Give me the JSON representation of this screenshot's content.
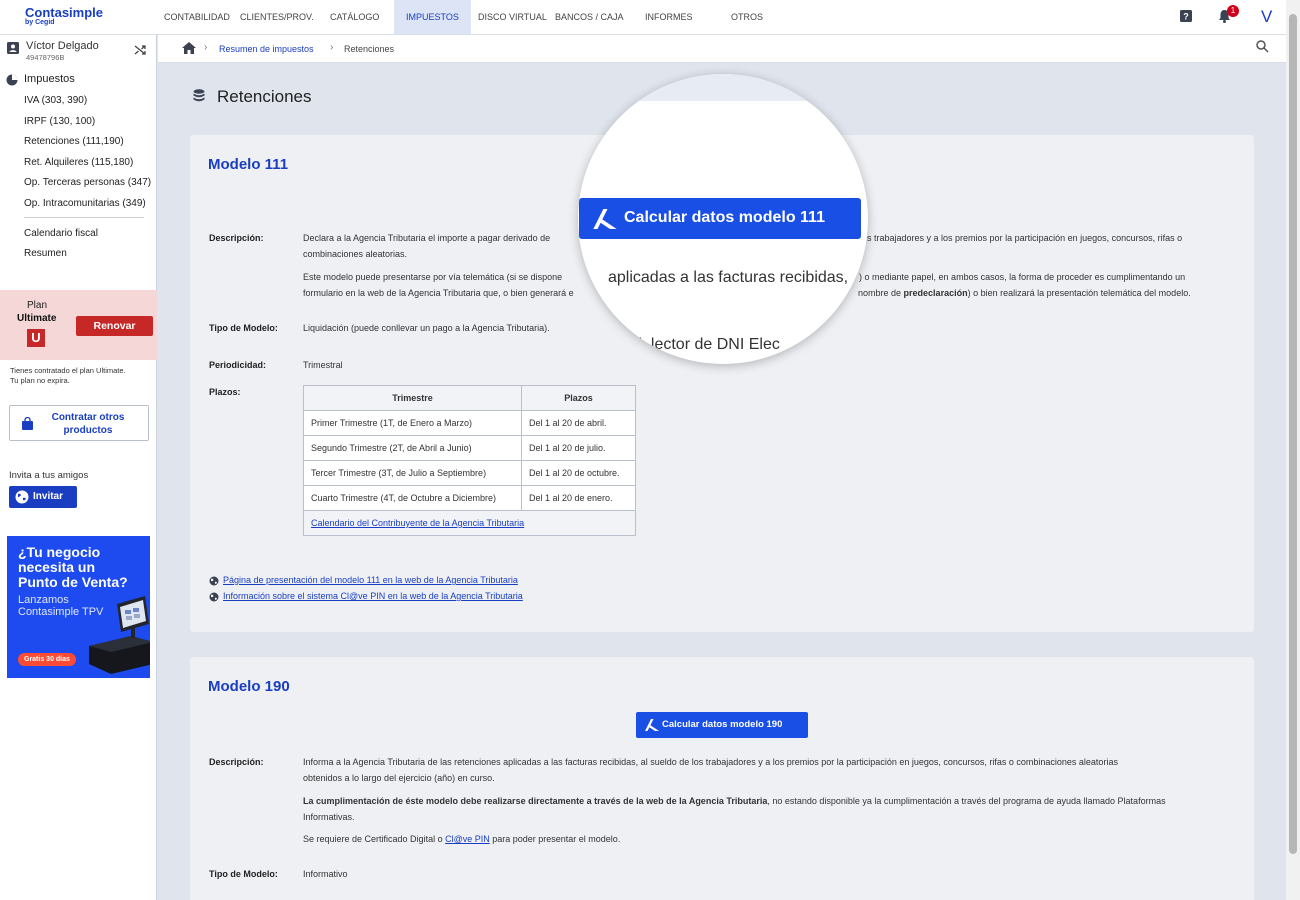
{
  "app": {
    "logo_main": "Contasimple",
    "logo_sub": "by Cegid"
  },
  "nav": {
    "items": [
      "CONTABILIDAD",
      "CLIENTES/PROV.",
      "CATÁLOGO",
      "IMPUESTOS",
      "DISCO VIRTUAL",
      "BANCOS / CAJA",
      "INFORMES",
      "OTROS"
    ],
    "active": "IMPUESTOS",
    "bell_count": "1",
    "user_initial": "V"
  },
  "user": {
    "name": "Víctor Delgado",
    "id": "49478796B"
  },
  "sidebar": {
    "section": "Impuestos",
    "items": [
      "IVA (303, 390)",
      "IRPF (130, 100)",
      "Retenciones (111,190)",
      "Ret. Alquileres (115,180)",
      "Op. Terceras personas (347)",
      "Op. Intracomunitarias (349)",
      "Calendario fiscal",
      "Resumen"
    ],
    "plan_label": "Plan",
    "plan_name": "Ultimate",
    "plan_badge": "U",
    "renew": "Renovar",
    "plan_note_1": "Tienes contratado el plan Ultimate.",
    "plan_note_2": "Tu plan no expira.",
    "contract_btn": "Contratar otros productos",
    "invite_label": "Invita a tus amigos",
    "invite_btn": "Invitar",
    "promo_title": "¿Tu negocio necesita un Punto de Venta?",
    "promo_sub": "Lanzamos Contasimple TPV",
    "promo_badge": "Gratis 30 días"
  },
  "breadcrumb": {
    "link": "Resumen de impuestos",
    "current": "Retenciones"
  },
  "page": {
    "title": "Retenciones"
  },
  "labels": {
    "desc": "Descripción:",
    "tipo": "Tipo de Modelo:",
    "periodicidad": "Periodicidad:",
    "plazos": "Plazos:"
  },
  "m111": {
    "title": "Modelo 111",
    "desc_1": "Declara a la Agencia Tributaria el importe a pagar derivado de",
    "desc_1b": "s trabajadores y a los premios por la participación en juegos, concursos, rifas o",
    "desc_2": "combinaciones aleatorias.",
    "desc_3a": "Este modelo puede presentarse por vía telemática (si se dispone",
    "desc_3b": ") o mediante papel, en ambos casos, la forma de proceder es cumplimentando un",
    "desc_4a": "formulario en la web de la Agencia Tributaria que, o bien generará e",
    "desc_4b": "nombre de",
    "desc_4c": "predeclaración",
    "desc_4d": ") o bien realizará la presentación telemática del modelo.",
    "tipo": "Liquidación (puede conllevar un pago a la Agencia Tributaria).",
    "periodicidad": "Trimestral",
    "table_headers": [
      "Trimestre",
      "Plazos"
    ],
    "table_rows": [
      [
        "Primer Trimestre (1T, de Enero a Marzo)",
        "Del 1 al 20 de abril."
      ],
      [
        "Segundo Trimestre (2T, de Abril a Junio)",
        "Del 1 al 20 de julio."
      ],
      [
        "Tercer Trimestre (3T, de Julio a Septiembre)",
        "Del 1 al 20 de octubre."
      ],
      [
        "Cuarto Trimestre (4T, de Octubre a Diciembre)",
        "Del 1 al 20 de enero."
      ]
    ],
    "table_link": "Calendario del Contribuyente de la Agencia Tributaria",
    "link_1": "Página de presentación del modelo 111 en la web de la Agencia Tributaria",
    "link_2": "Información sobre el sistema Cl@ve PIN en la web de la Agencia Tributaria"
  },
  "magnifier": {
    "button": "Calcular datos modelo 111",
    "line_1": "aplicadas a las facturas recibidas, ",
    "line_2": "ial, lector de DNI Elec"
  },
  "m190": {
    "title": "Modelo 190",
    "button": "Calcular datos modelo 190",
    "desc_1": "Informa a la Agencia Tributaria de las retenciones aplicadas a las facturas recibidas, al sueldo de los trabajadores y a los premios por la participación en juegos, concursos, rifas o combinaciones aleatorias",
    "desc_2": "obtenidos a lo largo del ejercicio (año) en curso.",
    "desc_3_bold": "La cumplimentación de éste modelo debe realizarse directamente a través de la web de la Agencia Tributaria",
    "desc_3_rest": ", no estando disponible ya la cumplimentación a través del programa de ayuda llamado Plataformas",
    "desc_4": "Informativas.",
    "desc_5a": "Se requiere de Certificado Digital o ",
    "desc_5_link": "Cl@ve PIN",
    "desc_5b": " para poder presentar el modelo.",
    "tipo": "Informativo"
  },
  "colors": {
    "brand": "#1a3ec2",
    "button": "#1a4fe6",
    "renew": "#c62828",
    "promo": "#1d4bf0"
  }
}
